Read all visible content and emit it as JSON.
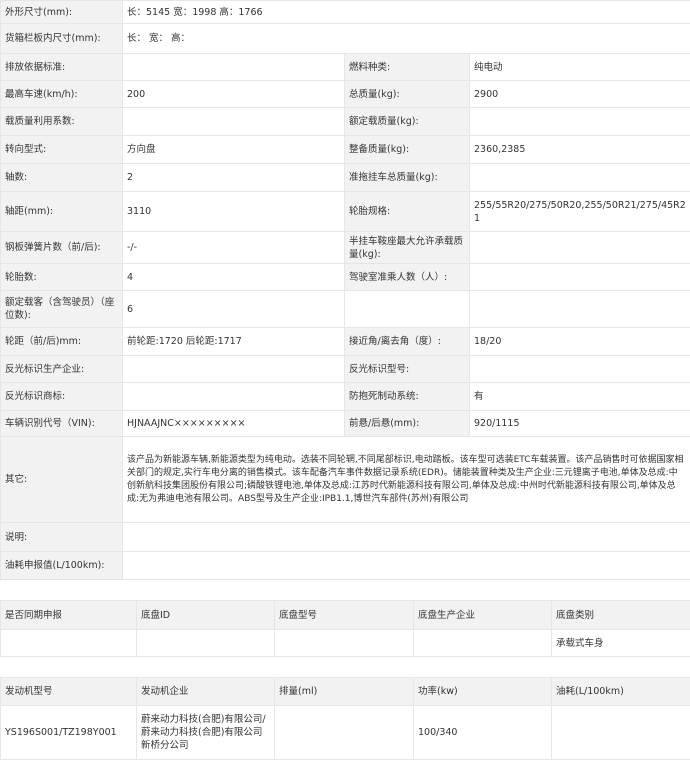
{
  "specs": {
    "outer_size": {
      "label": "外形尺寸(mm):",
      "value": "长：5145 宽：1998 高：1766"
    },
    "cargo_box": {
      "label": "货箱栏板内尺寸(mm):",
      "value": "长：  宽：  高："
    },
    "emission_std": {
      "label": "排放依据标准:",
      "value": ""
    },
    "fuel_type": {
      "label": "燃料种类:",
      "value": "纯电动"
    },
    "max_speed": {
      "label": "最高车速(km/h):",
      "value": "200"
    },
    "total_mass": {
      "label": "总质量(kg):",
      "value": "2900"
    },
    "load_util": {
      "label": "载质量利用系数:",
      "value": ""
    },
    "rated_load": {
      "label": "额定载质量(kg):",
      "value": ""
    },
    "steering": {
      "label": "转向型式:",
      "value": "方向盘"
    },
    "curb_weight": {
      "label": "整备质量(kg):",
      "value": "2360,2385"
    },
    "axles": {
      "label": "轴数:",
      "value": "2"
    },
    "trailer_mass": {
      "label": "准拖挂车总质量(kg):",
      "value": ""
    },
    "wheelbase": {
      "label": "轴距(mm):",
      "value": "3110"
    },
    "tire_spec": {
      "label": "轮胎规格:",
      "value": "255/55R20/275/50R20,255/50R21/275/45R21"
    },
    "leaf_springs": {
      "label": "钢板弹簧片数（前/后):",
      "value": "-/-"
    },
    "saddle_load": {
      "label": "半挂车鞍座最大允许承载质量(kg):",
      "value": ""
    },
    "tire_count": {
      "label": "轮胎数:",
      "value": "4"
    },
    "cab_passengers": {
      "label": "驾驶室准乘人数（人）:",
      "value": ""
    },
    "rated_seats": {
      "label": "额定载客（含驾驶员）（座位数):",
      "value": "6"
    },
    "track": {
      "label": "轮距（前/后)mm:",
      "value": "前轮距:1720 后轮距:1717"
    },
    "approach_angle": {
      "label": "接近角/离去角（度）:",
      "value": "18/20"
    },
    "reflector_maker": {
      "label": "反光标识生产企业:",
      "value": ""
    },
    "reflector_model": {
      "label": "反光标识型号:",
      "value": ""
    },
    "reflector_brand": {
      "label": "反光标识商标:",
      "value": ""
    },
    "abs": {
      "label": "防抱死制动系统:",
      "value": "有"
    },
    "vin": {
      "label": "车辆识别代号（VIN):",
      "value": "HJNAAJNC×××××××××"
    },
    "overhang": {
      "label": "前悬/后悬(mm):",
      "value": "920/1115"
    },
    "other": {
      "label": "其它:",
      "value": "该产品为新能源车辆,新能源类型为纯电动。选装不同轮辋,不同尾部标识,电动踏板。该车型可选装ETC车载装置。该产品销售时可依据国家相关部门的规定,实行车电分离的销售模式。该车配备汽车事件数据记录系统(EDR)。储能装置种类及生产企业:三元锂离子电池,单体及总成:中创新航科技集团股份有限公司;磷酸铁锂电池,单体及总成:江苏时代新能源科技有限公司,单体及总成:中州时代新能源科技有限公司,单体及总成:无为弗迪电池有限公司。ABS型号及生产企业:IPB1.1,博世汽车部件(苏州)有限公司"
    },
    "note": {
      "label": "说明:",
      "value": ""
    },
    "fuel_report": {
      "label": "油耗申报值(L/100km):",
      "value": ""
    }
  },
  "chassis": {
    "headers": [
      "是否同期申报",
      "底盘ID",
      "底盘型号",
      "底盘生产企业",
      "底盘类别"
    ],
    "row": [
      "",
      "",
      "",
      "",
      "承载式车身"
    ]
  },
  "engine": {
    "headers": [
      "发动机型号",
      "发动机企业",
      "排量(ml)",
      "功率(kw)",
      "油耗(L/100km)"
    ],
    "row": [
      "YS196S001/TZ198Y001",
      "蔚来动力科技(合肥)有限公司/蔚来动力科技(合肥)有限公司新桥分公司",
      "",
      "100/340",
      ""
    ]
  }
}
